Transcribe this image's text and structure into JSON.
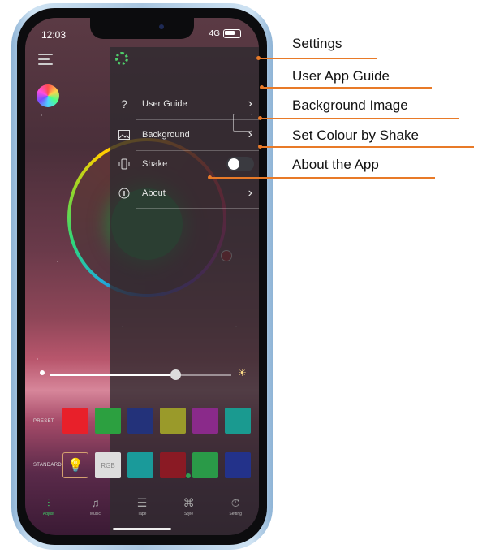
{
  "status_bar": {
    "time": "12:03",
    "signal": "4G"
  },
  "settings_menu": {
    "items": [
      {
        "label": "User Guide",
        "icon": "question-icon"
      },
      {
        "label": "Background",
        "icon": "image-icon"
      },
      {
        "label": "Shake",
        "icon": "phone-shake-icon",
        "toggle_on": false
      },
      {
        "label": "About",
        "icon": "info-icon"
      }
    ]
  },
  "brightness": {
    "value": 0.69
  },
  "preset": {
    "label": "PRESET",
    "colors": [
      "#e8202a",
      "#2ca040",
      "#23327a",
      "#9a9a2a",
      "#8a2a8a",
      "#1a9a90"
    ]
  },
  "standard": {
    "label": "STANDARD",
    "rgb_label": "RGB",
    "colors": [
      "#1a9a9a",
      "#8a1a24",
      "#2a9a48",
      "#23328a"
    ]
  },
  "tabs": [
    {
      "label": "Adjust",
      "icon": "sliders-icon",
      "active": true
    },
    {
      "label": "Music",
      "icon": "music-icon",
      "active": false
    },
    {
      "label": "Tape",
      "icon": "tape-icon",
      "active": false
    },
    {
      "label": "Style",
      "icon": "style-icon",
      "active": false
    },
    {
      "label": "Setting",
      "icon": "timer-icon",
      "active": false
    }
  ],
  "callouts": [
    {
      "text": "Settings"
    },
    {
      "text": "User App Guide"
    },
    {
      "text": "Background Image"
    },
    {
      "text": "Set Colour by Shake"
    },
    {
      "text": "About the App"
    }
  ],
  "colors": {
    "accent_green": "#3fcf66",
    "callout_orange": "#e87a28"
  }
}
